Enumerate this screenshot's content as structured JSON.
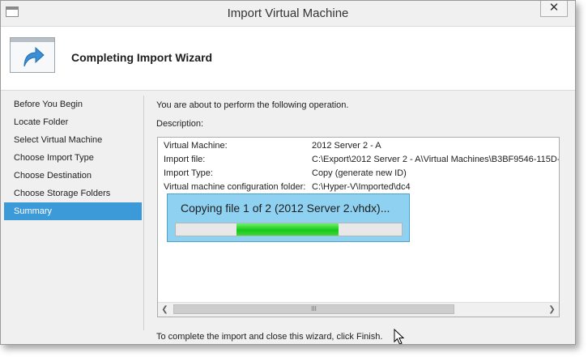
{
  "window": {
    "title": "Import Virtual Machine",
    "close_label": "✕"
  },
  "header": {
    "title": "Completing Import Wizard",
    "icon": "import-arrow-icon"
  },
  "nav": {
    "items": [
      {
        "label": "Before You Begin",
        "active": false
      },
      {
        "label": "Locate Folder",
        "active": false
      },
      {
        "label": "Select Virtual Machine",
        "active": false
      },
      {
        "label": "Choose Import Type",
        "active": false
      },
      {
        "label": "Choose Destination",
        "active": false
      },
      {
        "label": "Choose Storage Folders",
        "active": false
      },
      {
        "label": "Summary",
        "active": true
      }
    ]
  },
  "main": {
    "intro": "You are about to perform the following operation.",
    "description_label": "Description:",
    "rows": [
      {
        "key": "Virtual Machine:",
        "value": "2012 Server 2 - A"
      },
      {
        "key": "Import file:",
        "value": "C:\\Export\\2012 Server 2 - A\\Virtual Machines\\B3BF9546-115D-"
      },
      {
        "key": "Import Type:",
        "value": "Copy (generate new ID)"
      },
      {
        "key": "Virtual machine configuration folder:",
        "value": "C:\\Hyper-V\\Imported\\dc4"
      }
    ],
    "scrollbar_grip": "III",
    "footer": "To complete the import and close this wizard, click Finish."
  },
  "progress": {
    "text": "Copying file 1 of 2 (2012 Server 2.vhdx)...",
    "fill_start": 0.27,
    "fill_end": 0.72
  },
  "colors": {
    "active_nav": "#3c9ad8",
    "progress_popup": "#8ed1f0",
    "progress_fill": "#18c818"
  }
}
